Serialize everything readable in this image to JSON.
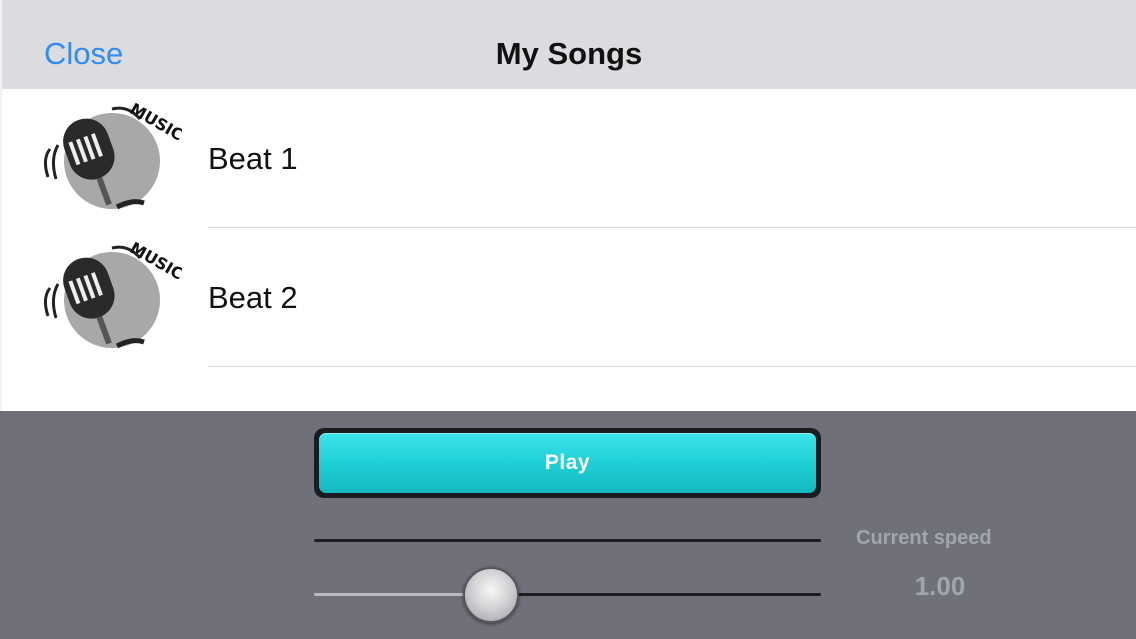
{
  "navbar": {
    "close_label": "Close",
    "title": "My Songs"
  },
  "songs": [
    {
      "title": "Beat 1",
      "thumb_text": "MUSIC",
      "thumb_icon": "microphone-icon"
    },
    {
      "title": "Beat 2",
      "thumb_text": "MUSIC",
      "thumb_icon": "microphone-icon"
    }
  ],
  "player": {
    "play_label": "Play",
    "speed_label": "Current speed",
    "speed_value": "1.00",
    "speed_slider_fraction": 0.35
  },
  "colors": {
    "accent_link": "#2f8cf0",
    "play_button": "#1fcfd6",
    "panel_bg": "#6f7079"
  }
}
